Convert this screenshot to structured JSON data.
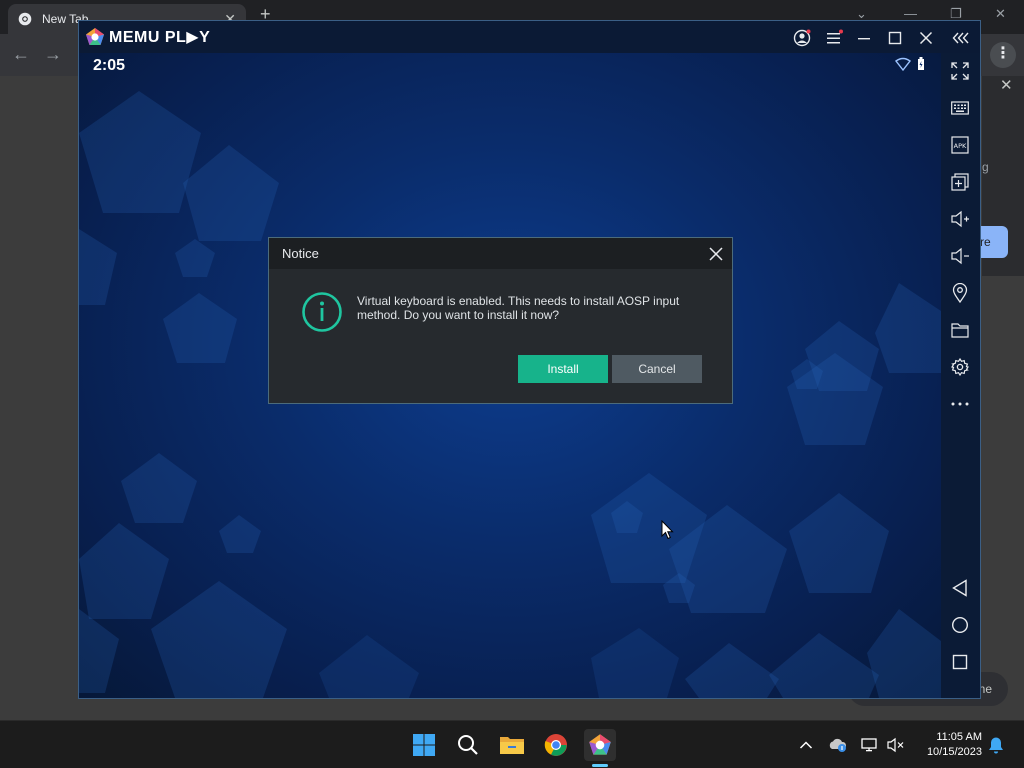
{
  "browser": {
    "tab_title": "New Tab",
    "tab_close": "✕",
    "new_tab": "+",
    "menu": "⋮",
    "side_panel_close": "✕",
    "side_panel_text_fragment": "g",
    "side_panel_button_fragment": "re",
    "side_panel_pill_fragment": "ne"
  },
  "emulator": {
    "brand_text": "MEMU PL▶Y",
    "status_time": "2:05"
  },
  "dialog": {
    "title": "Notice",
    "message": "Virtual keyboard is enabled. This needs to install AOSP input method. Do you want to install it now?",
    "install_label": "Install",
    "cancel_label": "Cancel"
  },
  "taskbar": {
    "time": "11:05 AM",
    "date": "10/15/2023"
  },
  "colors": {
    "install_button": "#17b38b",
    "cancel_button": "#4f5a62",
    "info_icon": "#1fc6a0",
    "android_bg": "#0a2c6b"
  }
}
